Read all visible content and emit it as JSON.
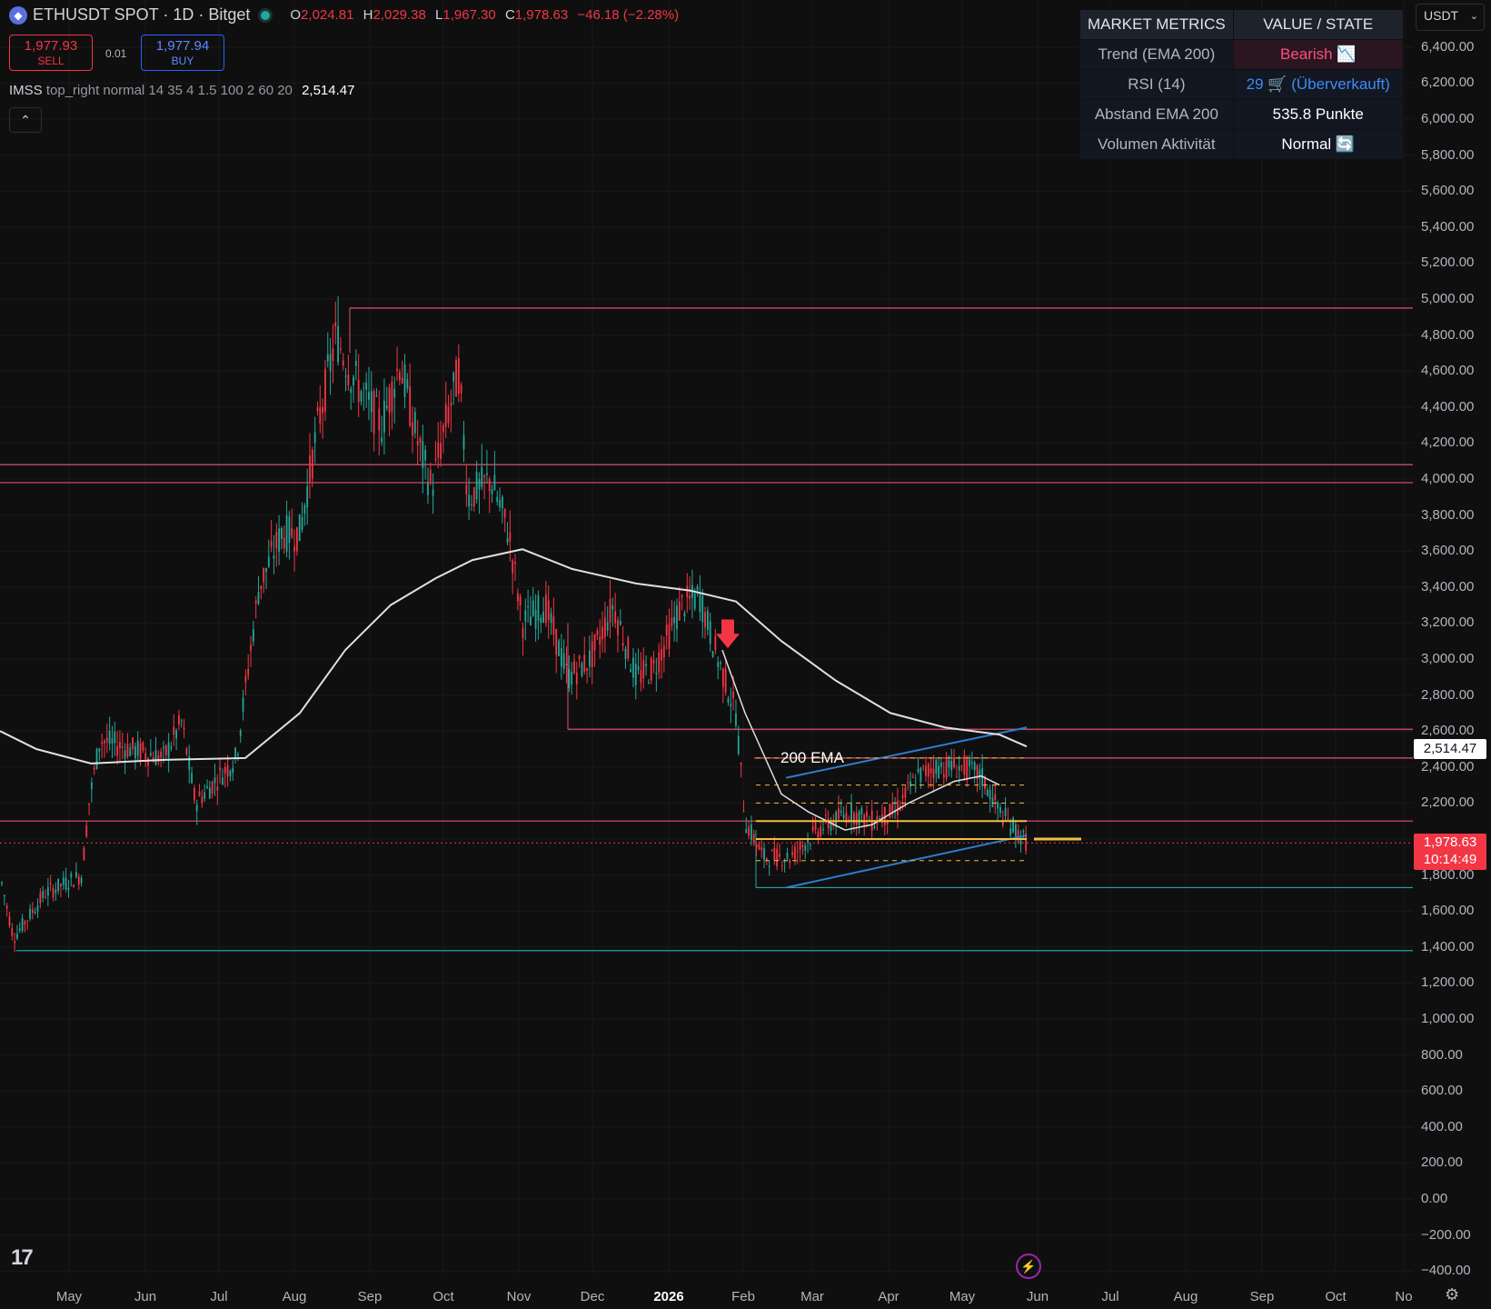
{
  "header": {
    "symbol_line": "ETHUSDT SPOT · 1D · Bitget",
    "o_label": "O",
    "o_value": "2,024.81",
    "h_label": "H",
    "h_value": "2,029.38",
    "l_label": "L",
    "l_value": "1,967.30",
    "c_label": "C",
    "c_value": "1,978.63",
    "change": "−46.18 (−2.28%)"
  },
  "trade": {
    "sell_price": "1,977.93",
    "sell_label": "SELL",
    "spread": "0.01",
    "buy_price": "1,977.94",
    "buy_label": "BUY"
  },
  "indicator": {
    "name": "IMSS",
    "params": "top_right normal 14 35 4 1.5 100 2 60 20",
    "value": "2,514.47"
  },
  "metrics_table": {
    "head_metric": "MARKET METRICS",
    "head_value": "VALUE / STATE",
    "rows": [
      {
        "metric": "Trend (EMA 200)",
        "value": "Bearish 📉"
      },
      {
        "metric": "RSI (14)",
        "value": "29 🛒 (Überverkauft)"
      },
      {
        "metric": "Abstand EMA 200",
        "value": "535.8 Punkte"
      },
      {
        "metric": "Volumen Aktivität",
        "value": "Normal 🔄"
      }
    ]
  },
  "currency_select": "USDT",
  "y_axis_labels": [
    "6,400.00",
    "6,200.00",
    "6,000.00",
    "5,800.00",
    "5,600.00",
    "5,400.00",
    "5,200.00",
    "5,000.00",
    "4,800.00",
    "4,600.00",
    "4,400.00",
    "4,200.00",
    "4,000.00",
    "3,800.00",
    "3,600.00",
    "3,400.00",
    "3,200.00",
    "3,000.00",
    "2,800.00",
    "2,600.00",
    "2,400.00",
    "2,200.00",
    "2,000.00",
    "1,800.00",
    "1,600.00",
    "1,400.00",
    "1,200.00",
    "1,000.00",
    "800.00",
    "600.00",
    "400.00",
    "200.00",
    "0.00",
    "−200.00",
    "−400.00"
  ],
  "x_axis_labels": [
    "May",
    "Jun",
    "Jul",
    "Aug",
    "Sep",
    "Oct",
    "Nov",
    "Dec",
    "2026",
    "Feb",
    "Mar",
    "Apr",
    "May",
    "Jun",
    "Jul",
    "Aug",
    "Sep",
    "Oct",
    "No"
  ],
  "price_tags": {
    "ema_value": "2,514.47",
    "last_price": "1,978.63",
    "countdown": "10:14:49"
  },
  "ema_label": "200 EMA",
  "colors": {
    "bull": "#26a69a",
    "bear": "#f23645",
    "ema": "#e0e0e0",
    "level": "#e05070",
    "support": "#26a69a",
    "channel": "#2e7dd1",
    "fib": "#f0c040"
  },
  "chart_data": {
    "type": "line",
    "symbol": "ETHUSDT",
    "timeframe": "1D",
    "x": [
      "May",
      "Jun",
      "Jul",
      "Aug",
      "Sep",
      "Oct",
      "Nov",
      "Dec",
      "2026",
      "Feb",
      "Mar",
      "Apr",
      "May",
      "Jun"
    ],
    "series": [
      {
        "name": "",
        "values": [
          1800,
          2500,
          2450,
          3700,
          4500,
          4400,
          3900,
          3000,
          3000,
          2300,
          1900,
          2100,
          2350,
          1978.63
        ]
      },
      {
        "name": "200 EMA",
        "values": [
          2550,
          2480,
          2470,
          2800,
          3300,
          3550,
          3600,
          3400,
          3350,
          3000,
          2750,
          2650,
          2600,
          2514.47
        ]
      }
    ],
    "horizontal_levels": [
      4950,
      4080,
      3980,
      2610,
      2450,
      2100,
      1730,
      1380
    ],
    "ylim": [
      -400,
      6500
    ],
    "grid": true
  }
}
